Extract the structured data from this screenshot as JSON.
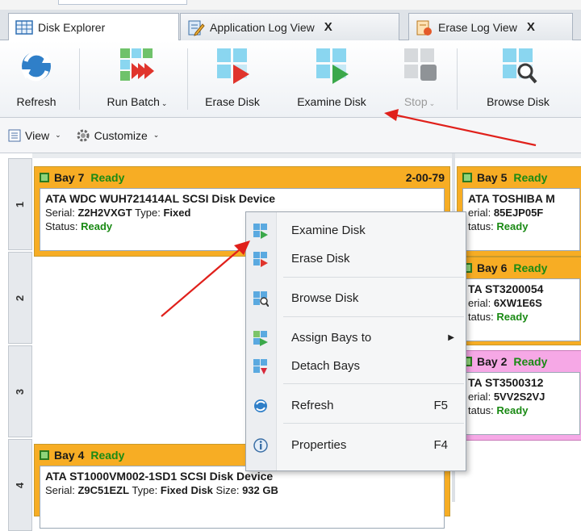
{
  "tabs": [
    {
      "label": "Disk Explorer",
      "active": true,
      "closable": false,
      "icon": "grid-icon"
    },
    {
      "label": "Application Log View",
      "active": false,
      "closable": true,
      "icon": "log-edit-icon"
    },
    {
      "label": "Erase Log View",
      "active": false,
      "closable": true,
      "icon": "erase-log-icon"
    }
  ],
  "tab_close_glyph": "X",
  "ribbon": {
    "refresh": "Refresh",
    "run_batch": "Run Batch",
    "erase_disk": "Erase Disk",
    "examine_disk": "Examine Disk",
    "stop": "Stop",
    "browse_disk": "Browse Disk"
  },
  "toolbar2": {
    "view": "View",
    "customize": "Customize"
  },
  "row_numbers": [
    "1",
    "2",
    "3",
    "4"
  ],
  "bays": {
    "bay7": {
      "name": "Bay 7",
      "status": "Ready",
      "port": "2-00-79",
      "model": "ATA WDC WUH721414AL SCSI Disk Device",
      "serial_label": "Serial:",
      "serial": "Z2H2VXGT",
      "type_label": "Type:",
      "type": "Fixed",
      "status_label": "Status:",
      "status_value": "Ready"
    },
    "bay5": {
      "name": "Bay 5",
      "status": "Ready",
      "model": "ATA TOSHIBA M",
      "serial_label": "erial:",
      "serial": "85EJP05F",
      "status_label": "tatus:",
      "status_value": "Ready"
    },
    "bay6": {
      "name": "Bay 6",
      "status": "Ready",
      "model": "TA ST3200054",
      "serial_label": "erial:",
      "serial": "6XW1E6S",
      "status_label": "tatus:",
      "status_value": "Ready"
    },
    "bay2": {
      "name": "Bay 2",
      "status": "Ready",
      "model": "TA ST3500312",
      "serial_label": "erial:",
      "serial": "5VV2S2VJ",
      "status_label": "tatus:",
      "status_value": "Ready"
    },
    "bay4": {
      "name": "Bay 4",
      "status": "Ready",
      "model": "ATA ST1000VM002-1SD1 SCSI Disk Device",
      "serial_label": "Serial:",
      "serial": "Z9C51EZL",
      "type_label": "Type:",
      "type": "Fixed Disk",
      "size_label": "Size:",
      "size": "932 GB"
    }
  },
  "context_menu": {
    "examine": "Examine Disk",
    "erase": "Erase Disk",
    "browse": "Browse Disk",
    "assign": "Assign Bays to",
    "detach": "Detach Bays",
    "refresh": "Refresh",
    "refresh_key": "F5",
    "properties": "Properties",
    "properties_key": "F4"
  },
  "colors": {
    "bay_ready": "#f7ad24",
    "bay_pink": "#f6a8e6",
    "ready_text": "#1a8a14",
    "annotation_arrow": "#e0201b"
  }
}
